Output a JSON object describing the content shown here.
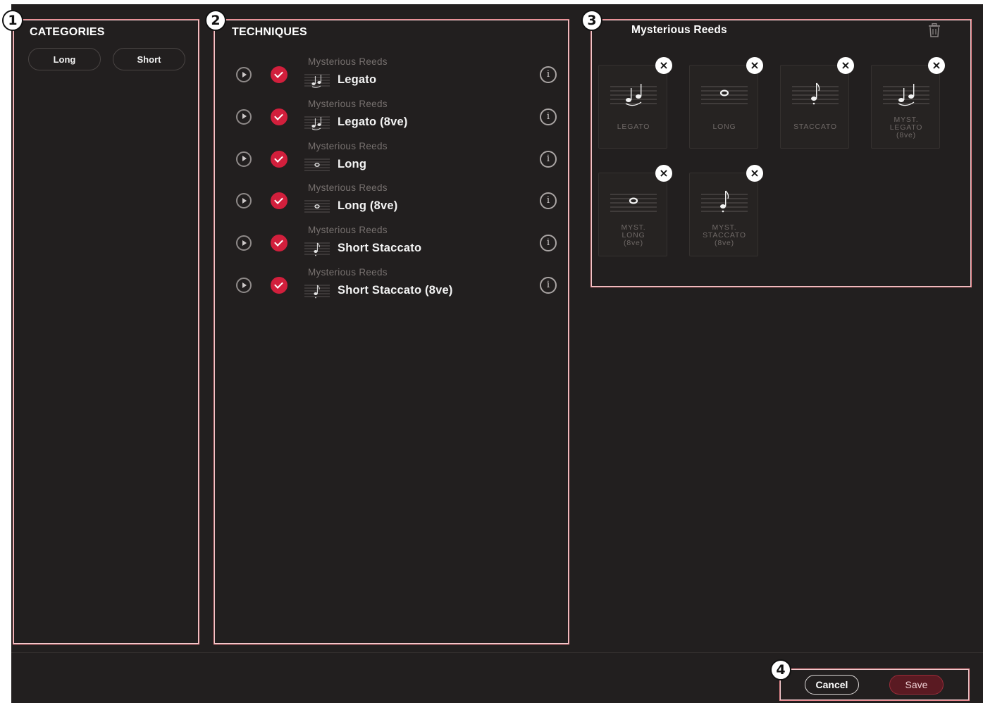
{
  "annotations": {
    "one": "1",
    "two": "2",
    "three": "3",
    "four": "4"
  },
  "categories": {
    "title": "CATEGORIES",
    "chips": [
      "Long",
      "Short"
    ]
  },
  "techniques": {
    "title": "TECHNIQUES",
    "items": [
      {
        "source": "Mysterious Reeds",
        "name": "Legato",
        "icon": "legato-icon"
      },
      {
        "source": "Mysterious Reeds",
        "name": "Legato (8ve)",
        "icon": "legato-icon"
      },
      {
        "source": "Mysterious Reeds",
        "name": "Long",
        "icon": "whole-note-icon"
      },
      {
        "source": "Mysterious Reeds",
        "name": "Long (8ve)",
        "icon": "whole-note-icon"
      },
      {
        "source": "Mysterious Reeds",
        "name": "Short Staccato",
        "icon": "staccato-icon"
      },
      {
        "source": "Mysterious Reeds",
        "name": "Short Staccato (8ve)",
        "icon": "staccato-icon"
      }
    ]
  },
  "preset": {
    "title": "Mysterious Reeds",
    "cards": [
      {
        "label": "LEGATO",
        "icon": "legato-icon"
      },
      {
        "label": "LONG",
        "icon": "whole-note-icon"
      },
      {
        "label": "STACCATO",
        "icon": "staccato-icon"
      },
      {
        "label": "MYST.\nLEGATO\n(8ve)",
        "icon": "legato-icon"
      },
      {
        "label": "MYST.\nLONG\n(8ve)",
        "icon": "whole-note-icon"
      },
      {
        "label": "MYST.\nSTACCATO\n(8ve)",
        "icon": "staccato-icon"
      }
    ],
    "remove_glyph": "×"
  },
  "footer": {
    "cancel": "Cancel",
    "save": "Save"
  },
  "colors": {
    "background": "#221f1f",
    "accent": "#d21f3c",
    "annotation_outline": "#e7868c"
  }
}
